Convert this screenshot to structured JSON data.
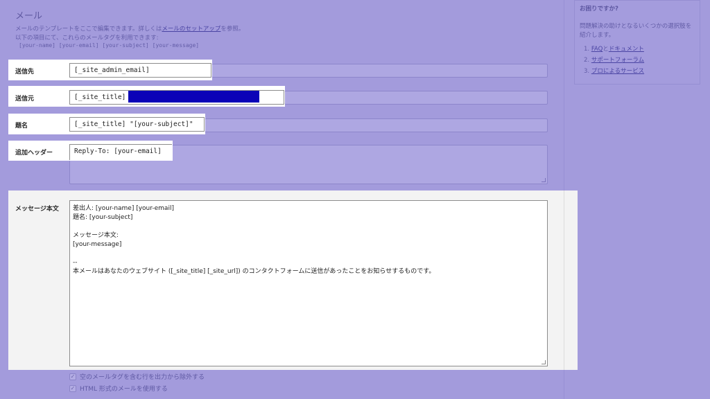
{
  "section": {
    "title": "メール",
    "desc_line1_pre": "メールのテンプレートをここで編集できます。詳しくは",
    "desc_line1_link": "メールのセットアップ",
    "desc_line1_post": "を参照。",
    "desc_line2": "以下の項目にて、これらのメールタグを利用できます:",
    "mail_tags": "[your-name] [your-email] [your-subject] [your-message]"
  },
  "fields": {
    "to": {
      "label": "送信先",
      "value": "[_site_admin_email]"
    },
    "from": {
      "label": "送信元",
      "value": "[_site_title]"
    },
    "subject": {
      "label": "題名",
      "value": "[_site_title] \"[your-subject]\""
    },
    "headers": {
      "label": "追加ヘッダー",
      "value": "Reply-To: [your-email]"
    },
    "body": {
      "label": "メッセージ本文",
      "lines": [
        "差出人: [your-name] [your-email]",
        "題名: [your-subject]",
        "",
        "メッセージ本文:",
        "[your-message]",
        "",
        "--",
        "本メールはあなたのウェブサイト ([_site_title] [_site_url]) のコンタクトフォームに送信があったことをお知らせするものです。"
      ]
    }
  },
  "options": {
    "exclude_blank": "空のメールタグを含む行を出力から除外する",
    "use_html": "HTML 形式のメールを使用する"
  },
  "sidebar": {
    "title": "お困りですか?",
    "desc_line1": "問題解決の助けとなるいくつかの選択肢を",
    "desc_line2": "紹介します。",
    "links": [
      {
        "num": "1.",
        "label": "FAQ",
        "join": "と",
        "label2": "ドキュメント"
      },
      {
        "num": "2.",
        "label": "サポートフォーラム"
      },
      {
        "num": "3.",
        "label": "プロによるサービス"
      }
    ]
  },
  "colors": {
    "overlay": "#a39bdc",
    "redaction": "#0b02b7"
  }
}
